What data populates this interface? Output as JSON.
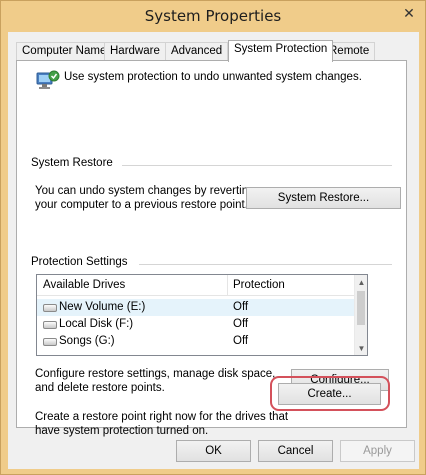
{
  "window": {
    "title": "System Properties",
    "close_glyph": "✕"
  },
  "tabs": [
    {
      "label": "Computer Name",
      "active": false
    },
    {
      "label": "Hardware",
      "active": false
    },
    {
      "label": "Advanced",
      "active": false
    },
    {
      "label": "System Protection",
      "active": true
    },
    {
      "label": "Remote",
      "active": false
    }
  ],
  "intro": {
    "text": "Use system protection to undo unwanted system changes.",
    "icon": "system-protection-icon"
  },
  "system_restore": {
    "label": "System Restore",
    "description_line1": "You can undo system changes by reverting",
    "description_line2": "your computer to a previous restore point.",
    "button": "System Restore..."
  },
  "protection_settings": {
    "label": "Protection Settings",
    "columns": [
      "Available Drives",
      "Protection"
    ],
    "drives": [
      {
        "name": "New Volume (E:)",
        "protection": "Off",
        "selected": true
      },
      {
        "name": "Local Disk (F:)",
        "protection": "Off",
        "selected": false
      },
      {
        "name": "Songs (G:)",
        "protection": "Off",
        "selected": false
      }
    ],
    "configure_line1": "Configure restore settings, manage disk space,",
    "configure_line2": "and delete restore points.",
    "configure_button": "Configure...",
    "create_line1": "Create a restore point right now for the drives that",
    "create_line2": "have system protection turned on.",
    "create_button": "Create..."
  },
  "footer": {
    "ok": "OK",
    "cancel": "Cancel",
    "apply": "Apply"
  },
  "colors": {
    "frame": "#f0cc8a",
    "highlight": "#d4515b",
    "selection": "#e5f3fb"
  }
}
